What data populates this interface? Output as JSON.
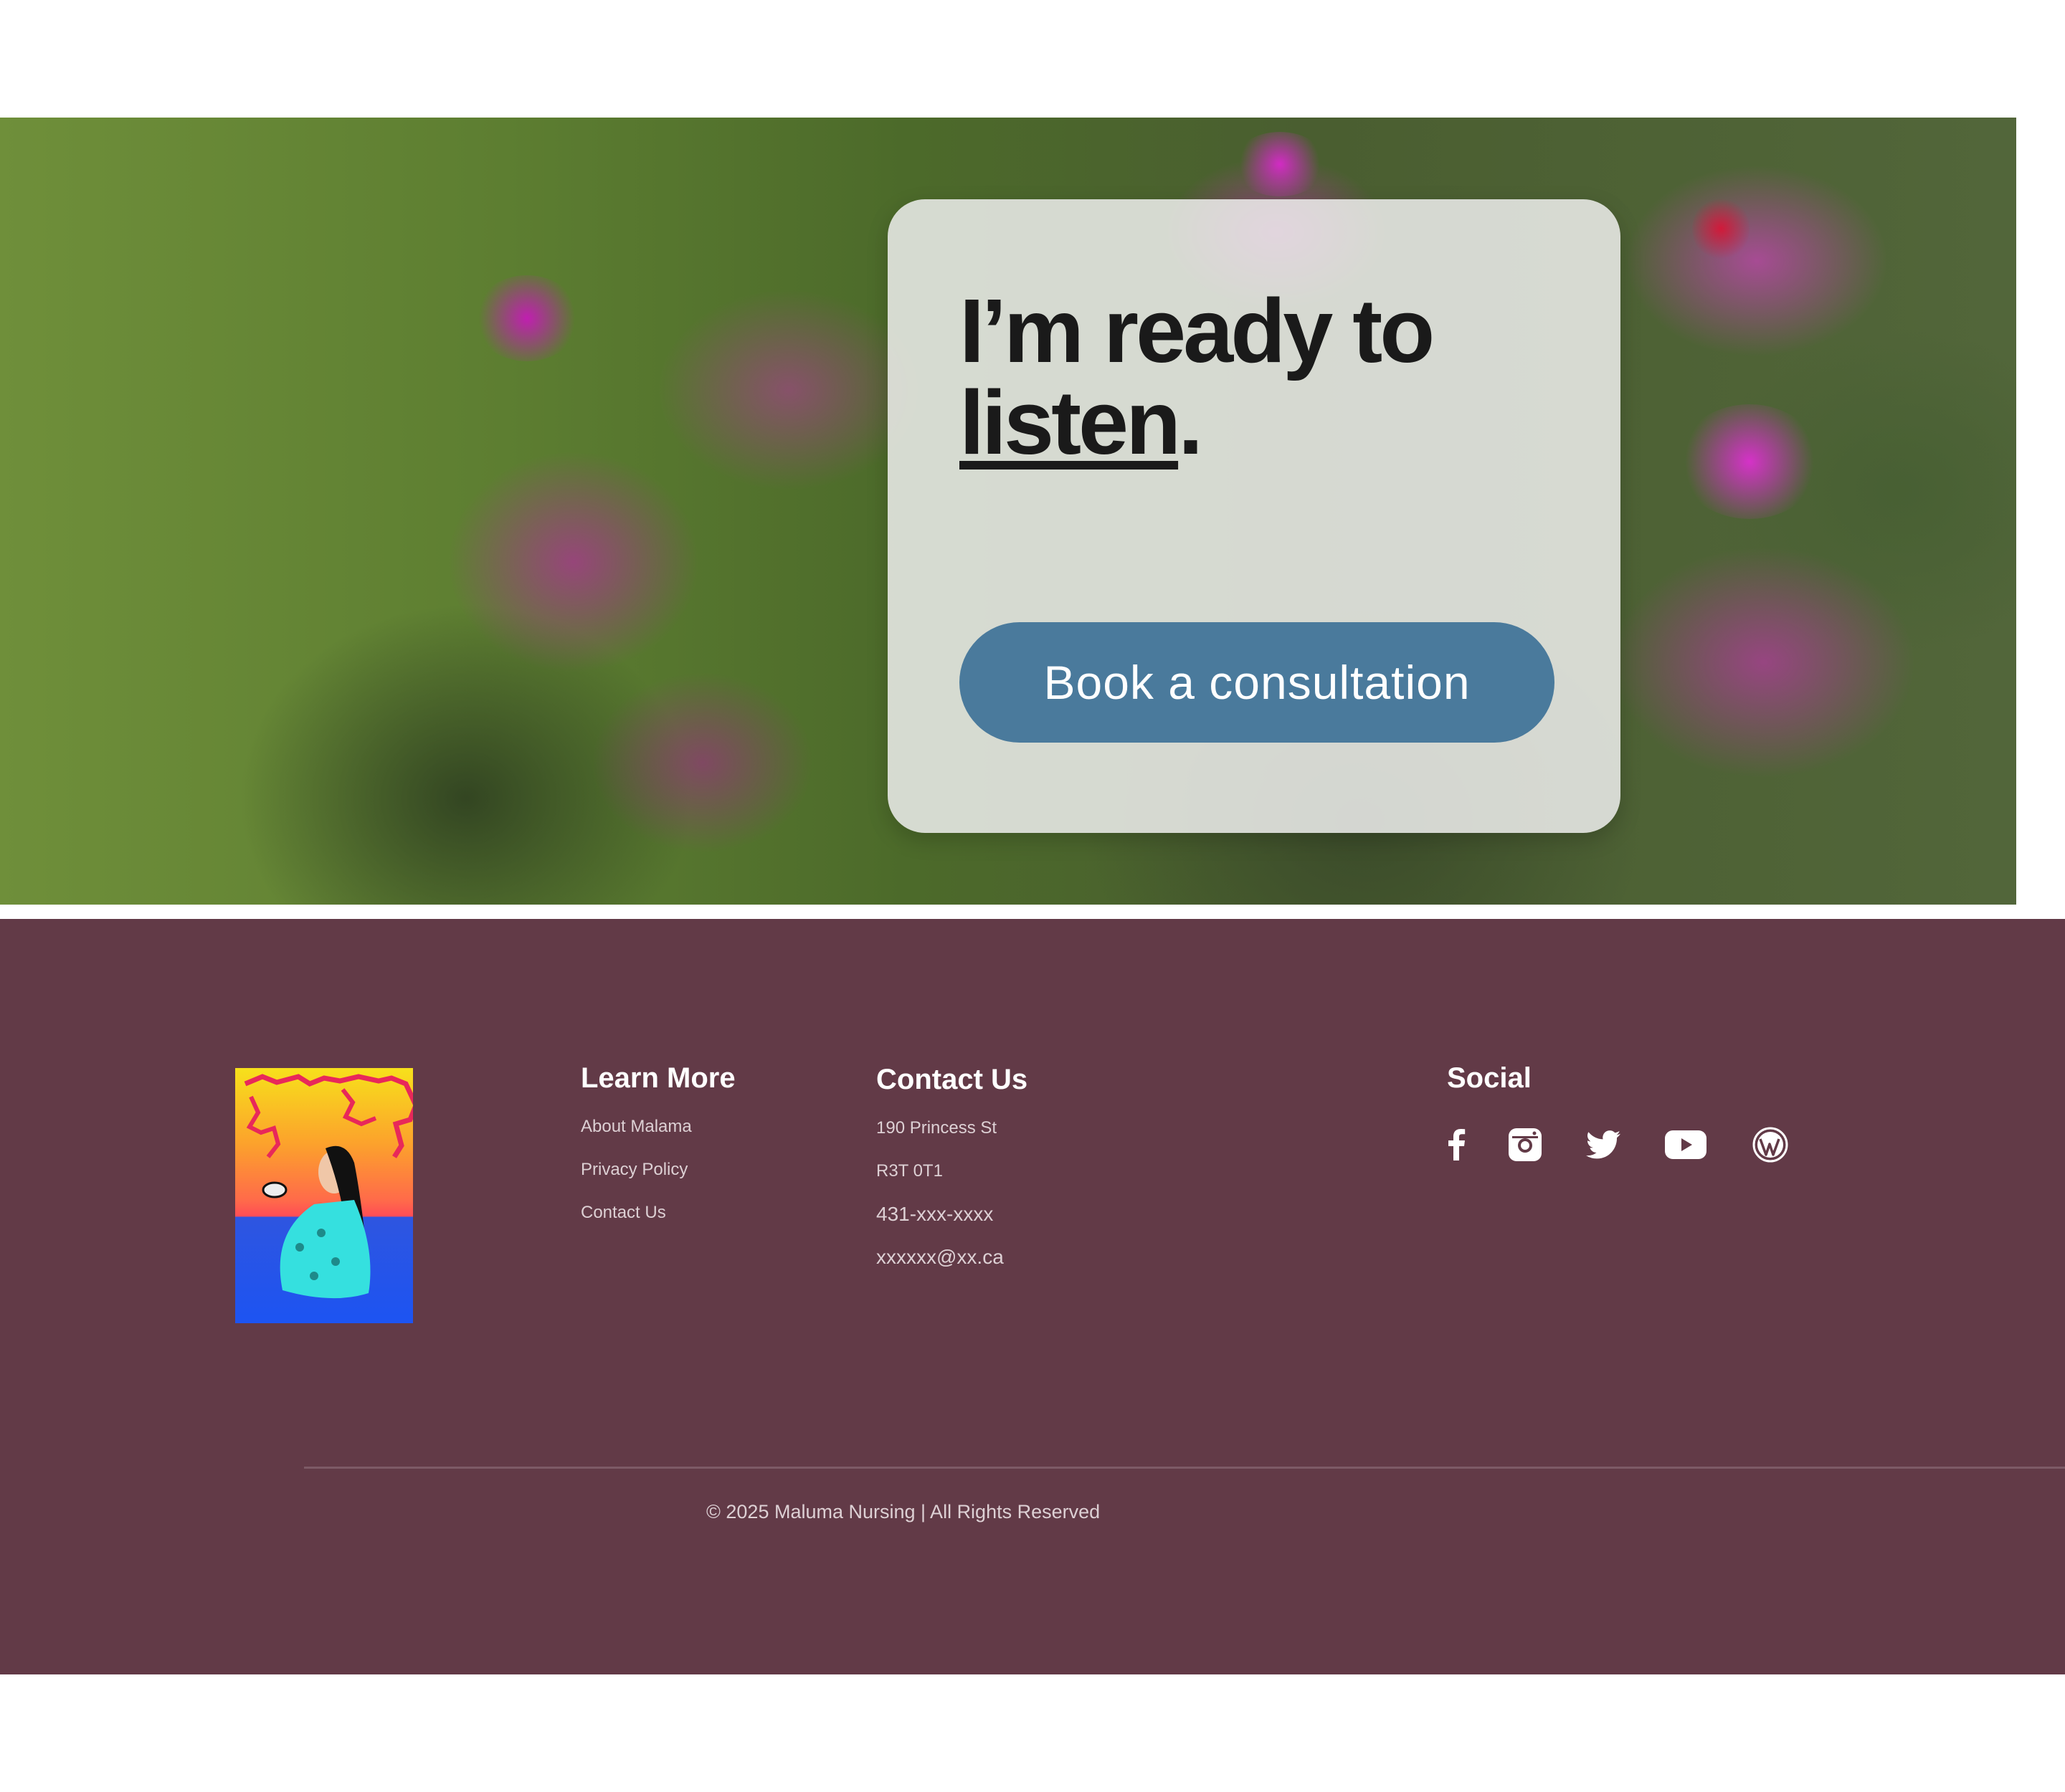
{
  "hero": {
    "headline_line1": "I’m ready to",
    "headline_word": "listen",
    "headline_punct": ".",
    "cta_label": "Book a consultation",
    "cta_color": "#4a7a9c"
  },
  "footer": {
    "background": "#623a47",
    "learn_more": {
      "title": "Learn More",
      "links": [
        "About Malama",
        "Privacy Policy",
        "Contact Us"
      ]
    },
    "contact": {
      "title": "Contact Us",
      "street": "190 Princess St",
      "postal": "R3T 0T1",
      "phone": "431-xxx-xxxx",
      "email": "xxxxxx@xx.ca"
    },
    "social": {
      "title": "Social",
      "icons": [
        "facebook-icon",
        "instagram-icon",
        "twitter-icon",
        "youtube-icon",
        "wordpress-icon"
      ]
    },
    "copyright": "© 2025 Maluma Nursing | All Rights Reserved"
  }
}
